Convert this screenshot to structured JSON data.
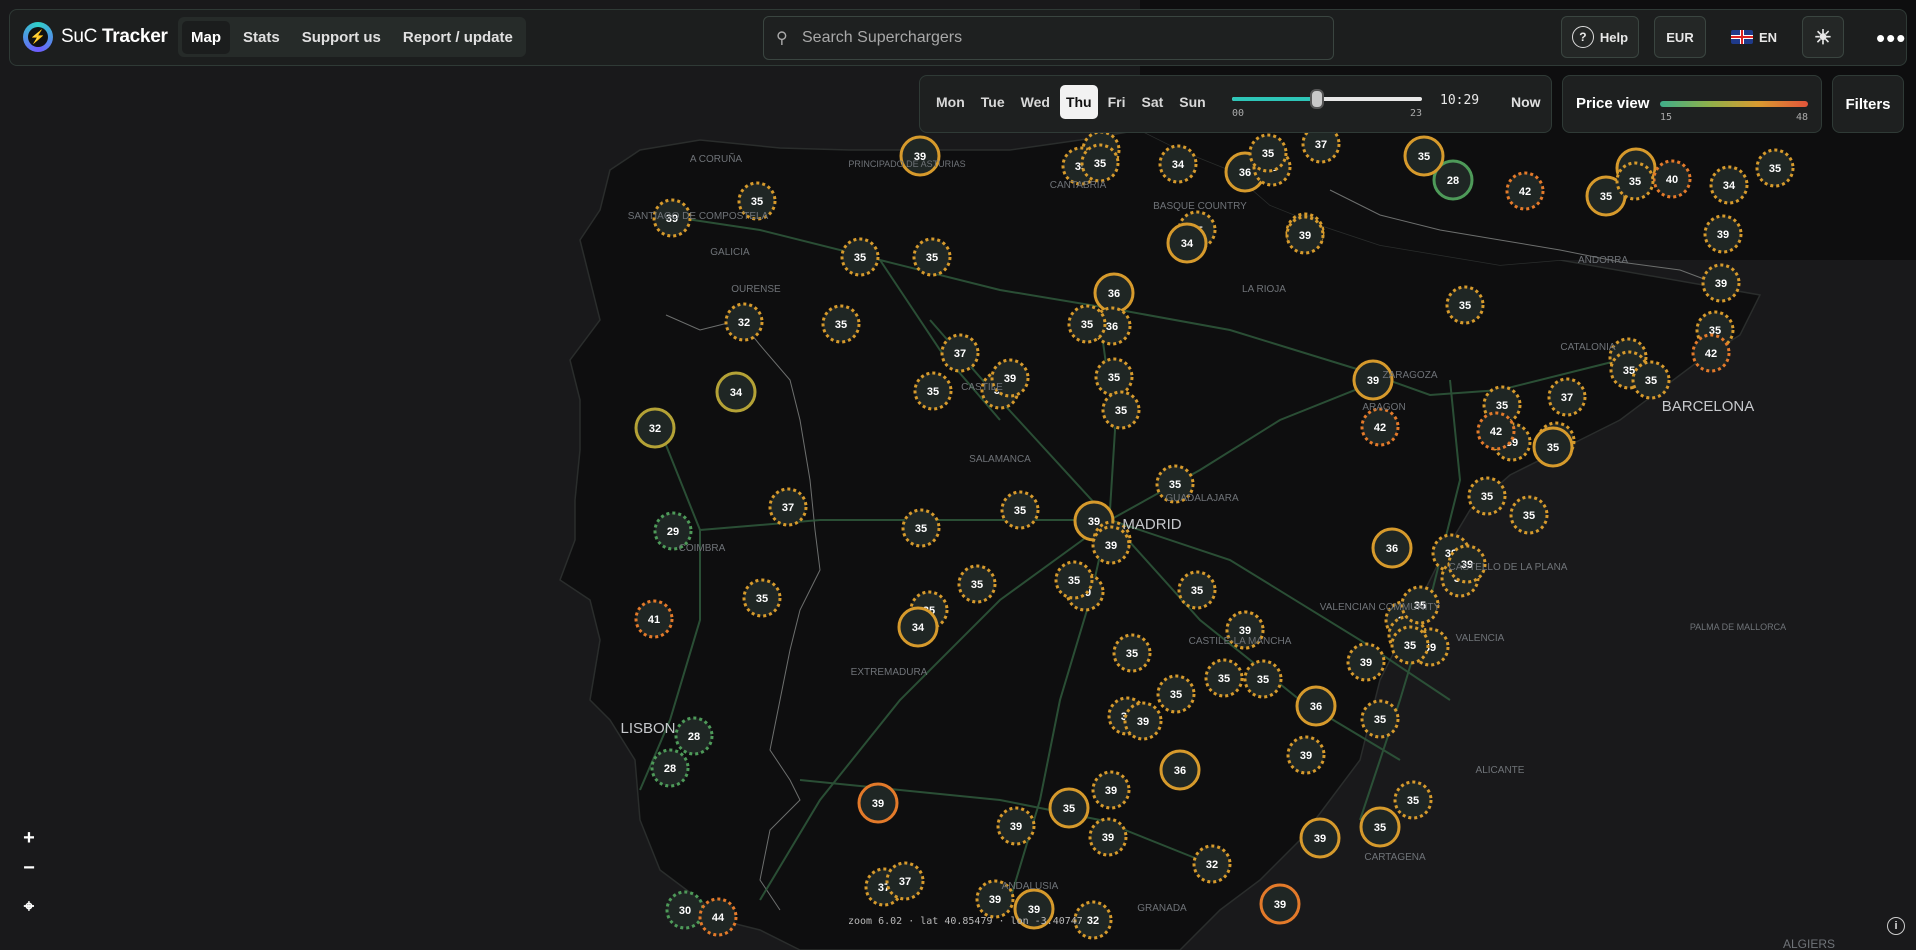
{
  "app": {
    "title_prefix": "SuC",
    "title_bold": "Tracker",
    "logo_icon": "bolt-icon"
  },
  "nav": [
    {
      "label": "Map",
      "active": true
    },
    {
      "label": "Stats",
      "active": false
    },
    {
      "label": "Support us",
      "active": false
    },
    {
      "label": "Report / update",
      "active": false
    }
  ],
  "search": {
    "placeholder": "Search Superchargers",
    "icon": "search-icon"
  },
  "header_buttons": {
    "help": "Help",
    "currency": "EUR",
    "language": "EN",
    "theme_icon": "sun-icon",
    "menu_icon": "more-icon"
  },
  "schedule": {
    "days": [
      "Mon",
      "Tue",
      "Wed",
      "Thu",
      "Fri",
      "Sat",
      "Sun"
    ],
    "selected_day": "Thu",
    "hour_min": "00",
    "hour_max": "23",
    "time": "10:29",
    "time_fraction": 0.448,
    "now_label": "Now"
  },
  "price_view": {
    "label": "Price view",
    "min": "15",
    "max": "48",
    "colors": [
      "#3fae8a",
      "#8fb04a",
      "#d99a30",
      "#e2543a"
    ]
  },
  "filters_label": "Filters",
  "map_controls": {
    "zoom_in": "+",
    "zoom_out": "−",
    "locate_icon": "locate-icon",
    "info_icon": "info-icon"
  },
  "status_bar": "zoom 6.02 · lat 40.85479 · lon -3.40747",
  "map_labels": [
    "A CORUÑA",
    "SANTIAGO DE COMPOSTELA",
    "GALICIA",
    "OURENSE",
    "PRINCIPADO DE ASTURIAS",
    "CANTABRIA",
    "BASQUE COUNTRY",
    "LA RIOJA",
    "CASTILE",
    "SALAMANCA",
    "ARAGON",
    "ZARAGOZA",
    "CATALONIA",
    "ANDORRA",
    "BARCELONA",
    "MADRID",
    "GUADALAJARA",
    "COIMBRA",
    "EXTREMADURA",
    "CASTILE-LA MANCHA",
    "VALENCIAN COMMUNITY",
    "VALENCIA",
    "CASTELLO DE LA PLANA",
    "ALICANTE",
    "CARTAGENA",
    "ANDALUSIA",
    "GRANADA",
    "LISBON",
    "PALMA DE MALLORCA",
    "ALGIERS"
  ],
  "station_colors": {
    "green": "#4e9a59",
    "olive": "#b4a236",
    "amber": "#d69a2c",
    "orange": "#e37a2a"
  },
  "stations": [
    {
      "price": "39",
      "style": "solid",
      "color": "amber"
    },
    {
      "price": "35",
      "style": "dashed",
      "color": "amber"
    },
    {
      "price": "39",
      "style": "dashed",
      "color": "amber"
    },
    {
      "price": "35",
      "style": "dashed",
      "color": "amber"
    },
    {
      "price": "39",
      "style": "dashed",
      "color": "amber"
    },
    {
      "price": "32",
      "style": "dashed",
      "color": "amber"
    },
    {
      "price": "35",
      "style": "dashed",
      "color": "amber"
    },
    {
      "price": "35",
      "style": "dashed",
      "color": "amber"
    },
    {
      "price": "34",
      "style": "solid",
      "color": "olive"
    },
    {
      "price": "32",
      "style": "solid",
      "color": "olive"
    },
    {
      "price": "35",
      "style": "dashed",
      "color": "amber"
    },
    {
      "price": "37",
      "style": "dashed",
      "color": "amber"
    },
    {
      "price": "35",
      "style": "dashed",
      "color": "amber"
    },
    {
      "price": "39",
      "style": "dashed",
      "color": "amber"
    },
    {
      "price": "35",
      "style": "dashed",
      "color": "amber"
    },
    {
      "price": "35",
      "style": "dashed",
      "color": "amber"
    },
    {
      "price": "36",
      "style": "solid",
      "color": "amber"
    },
    {
      "price": "36",
      "style": "dashed",
      "color": "amber"
    },
    {
      "price": "35",
      "style": "dashed",
      "color": "amber"
    },
    {
      "price": "35",
      "style": "dashed",
      "color": "amber"
    },
    {
      "price": "39",
      "style": "dashed",
      "color": "amber"
    },
    {
      "price": "34",
      "style": "dashed",
      "color": "amber"
    },
    {
      "price": "36",
      "style": "solid",
      "color": "amber"
    },
    {
      "price": "35",
      "style": "dashed",
      "color": "amber"
    },
    {
      "price": "37",
      "style": "dashed",
      "color": "amber"
    },
    {
      "price": "35",
      "style": "dashed",
      "color": "amber"
    },
    {
      "price": "34",
      "style": "solid",
      "color": "amber"
    },
    {
      "price": "39",
      "style": "dashed",
      "color": "amber"
    },
    {
      "price": "35",
      "style": "dashed",
      "color": "amber"
    },
    {
      "price": "39",
      "style": "solid",
      "color": "amber"
    },
    {
      "price": "35",
      "style": "dashed",
      "color": "amber"
    },
    {
      "price": "29",
      "style": "dashed",
      "color": "green"
    },
    {
      "price": "37",
      "style": "dashed",
      "color": "amber"
    },
    {
      "price": "35",
      "style": "dashed",
      "color": "amber"
    },
    {
      "price": "41",
      "style": "dashed",
      "color": "orange"
    },
    {
      "price": "35",
      "style": "dashed",
      "color": "amber"
    },
    {
      "price": "34",
      "style": "solid",
      "color": "amber"
    },
    {
      "price": "35",
      "style": "dashed",
      "color": "amber"
    },
    {
      "price": "35",
      "style": "dashed",
      "color": "amber"
    },
    {
      "price": "28",
      "style": "dashed",
      "color": "green"
    },
    {
      "price": "28",
      "style": "dashed",
      "color": "green"
    },
    {
      "price": "39",
      "style": "solid",
      "color": "orange"
    },
    {
      "price": "35",
      "style": "dashed",
      "color": "amber"
    },
    {
      "price": "39",
      "style": "dashed",
      "color": "amber"
    },
    {
      "price": "35",
      "style": "dashed",
      "color": "amber"
    },
    {
      "price": "39",
      "style": "solid",
      "color": "amber"
    },
    {
      "price": "39",
      "style": "dashed",
      "color": "amber"
    },
    {
      "price": "35",
      "style": "dashed",
      "color": "amber"
    },
    {
      "price": "35",
      "style": "dashed",
      "color": "amber"
    },
    {
      "price": "39",
      "style": "dashed",
      "color": "amber"
    },
    {
      "price": "35",
      "style": "dashed",
      "color": "amber"
    },
    {
      "price": "35",
      "style": "dashed",
      "color": "amber"
    },
    {
      "price": "35",
      "style": "dashed",
      "color": "amber"
    },
    {
      "price": "36",
      "style": "solid",
      "color": "amber"
    },
    {
      "price": "35",
      "style": "dashed",
      "color": "amber"
    },
    {
      "price": "39",
      "style": "dashed",
      "color": "amber"
    },
    {
      "price": "32",
      "style": "dashed",
      "color": "amber"
    },
    {
      "price": "39",
      "style": "solid",
      "color": "orange"
    },
    {
      "price": "37",
      "style": "dashed",
      "color": "amber"
    },
    {
      "price": "37",
      "style": "dashed",
      "color": "amber"
    },
    {
      "price": "32",
      "style": "dashed",
      "color": "amber"
    },
    {
      "price": "39",
      "style": "solid",
      "color": "amber"
    },
    {
      "price": "39",
      "style": "dashed",
      "color": "amber"
    },
    {
      "price": "30",
      "style": "dashed",
      "color": "green"
    },
    {
      "price": "44",
      "style": "dashed",
      "color": "orange"
    },
    {
      "price": "35",
      "style": "dashed",
      "color": "amber"
    },
    {
      "price": "35",
      "style": "dashed",
      "color": "amber"
    },
    {
      "price": "39",
      "style": "dashed",
      "color": "amber"
    },
    {
      "price": "35",
      "style": "solid",
      "color": "amber"
    },
    {
      "price": "39",
      "style": "dashed",
      "color": "amber"
    },
    {
      "price": "39",
      "style": "dashed",
      "color": "amber"
    },
    {
      "price": "39",
      "style": "dashed",
      "color": "amber"
    },
    {
      "price": "36",
      "style": "solid",
      "color": "amber"
    },
    {
      "price": "35",
      "style": "dashed",
      "color": "amber"
    },
    {
      "price": "39",
      "style": "dashed",
      "color": "amber"
    },
    {
      "price": "39",
      "style": "dashed",
      "color": "amber"
    },
    {
      "price": "35",
      "style": "solid",
      "color": "amber"
    },
    {
      "price": "39",
      "style": "solid",
      "color": "amber"
    },
    {
      "price": "35",
      "style": "dashed",
      "color": "amber"
    },
    {
      "price": "35",
      "style": "dashed",
      "color": "amber"
    },
    {
      "price": "39",
      "style": "dashed",
      "color": "amber"
    },
    {
      "price": "39",
      "style": "dashed",
      "color": "amber"
    },
    {
      "price": "35",
      "style": "dashed",
      "color": "amber"
    },
    {
      "price": "35",
      "style": "dashed",
      "color": "amber"
    },
    {
      "price": "36",
      "style": "solid",
      "color": "amber"
    },
    {
      "price": "35",
      "style": "dashed",
      "color": "amber"
    },
    {
      "price": "39",
      "style": "dashed",
      "color": "amber"
    },
    {
      "price": "34",
      "style": "dashed",
      "color": "amber"
    },
    {
      "price": "39",
      "style": "dashed",
      "color": "amber"
    },
    {
      "price": "35",
      "style": "dashed",
      "color": "amber"
    },
    {
      "price": "35",
      "style": "dashed",
      "color": "amber"
    },
    {
      "price": "39",
      "style": "dashed",
      "color": "amber"
    },
    {
      "price": "37",
      "style": "dashed",
      "color": "amber"
    },
    {
      "price": "34",
      "style": "dashed",
      "color": "amber"
    },
    {
      "price": "35",
      "style": "dashed",
      "color": "amber"
    },
    {
      "price": "42",
      "style": "dashed",
      "color": "orange"
    },
    {
      "price": "42",
      "style": "dashed",
      "color": "orange"
    },
    {
      "price": "35",
      "style": "solid",
      "color": "amber"
    },
    {
      "price": "28",
      "style": "solid",
      "color": "green"
    },
    {
      "price": "35",
      "style": "solid",
      "color": "amber"
    },
    {
      "price": "35",
      "style": "solid",
      "color": "amber"
    },
    {
      "price": "35",
      "style": "solid",
      "color": "amber"
    },
    {
      "price": "40",
      "style": "dashed",
      "color": "orange"
    },
    {
      "price": "42",
      "style": "dashed",
      "color": "orange"
    },
    {
      "price": "35",
      "style": "dashed",
      "color": "amber"
    },
    {
      "price": "34",
      "style": "dashed",
      "color": "amber"
    },
    {
      "price": "35",
      "style": "dashed",
      "color": "amber"
    },
    {
      "price": "39",
      "style": "dashed",
      "color": "amber"
    },
    {
      "price": "39",
      "style": "dashed",
      "color": "amber"
    },
    {
      "price": "35",
      "style": "dashed",
      "color": "amber"
    },
    {
      "price": "42",
      "style": "dashed",
      "color": "orange"
    },
    {
      "price": "37",
      "style": "dashed",
      "color": "amber"
    },
    {
      "price": "35",
      "style": "dashed",
      "color": "amber"
    },
    {
      "price": "35",
      "style": "dashed",
      "color": "amber"
    }
  ]
}
